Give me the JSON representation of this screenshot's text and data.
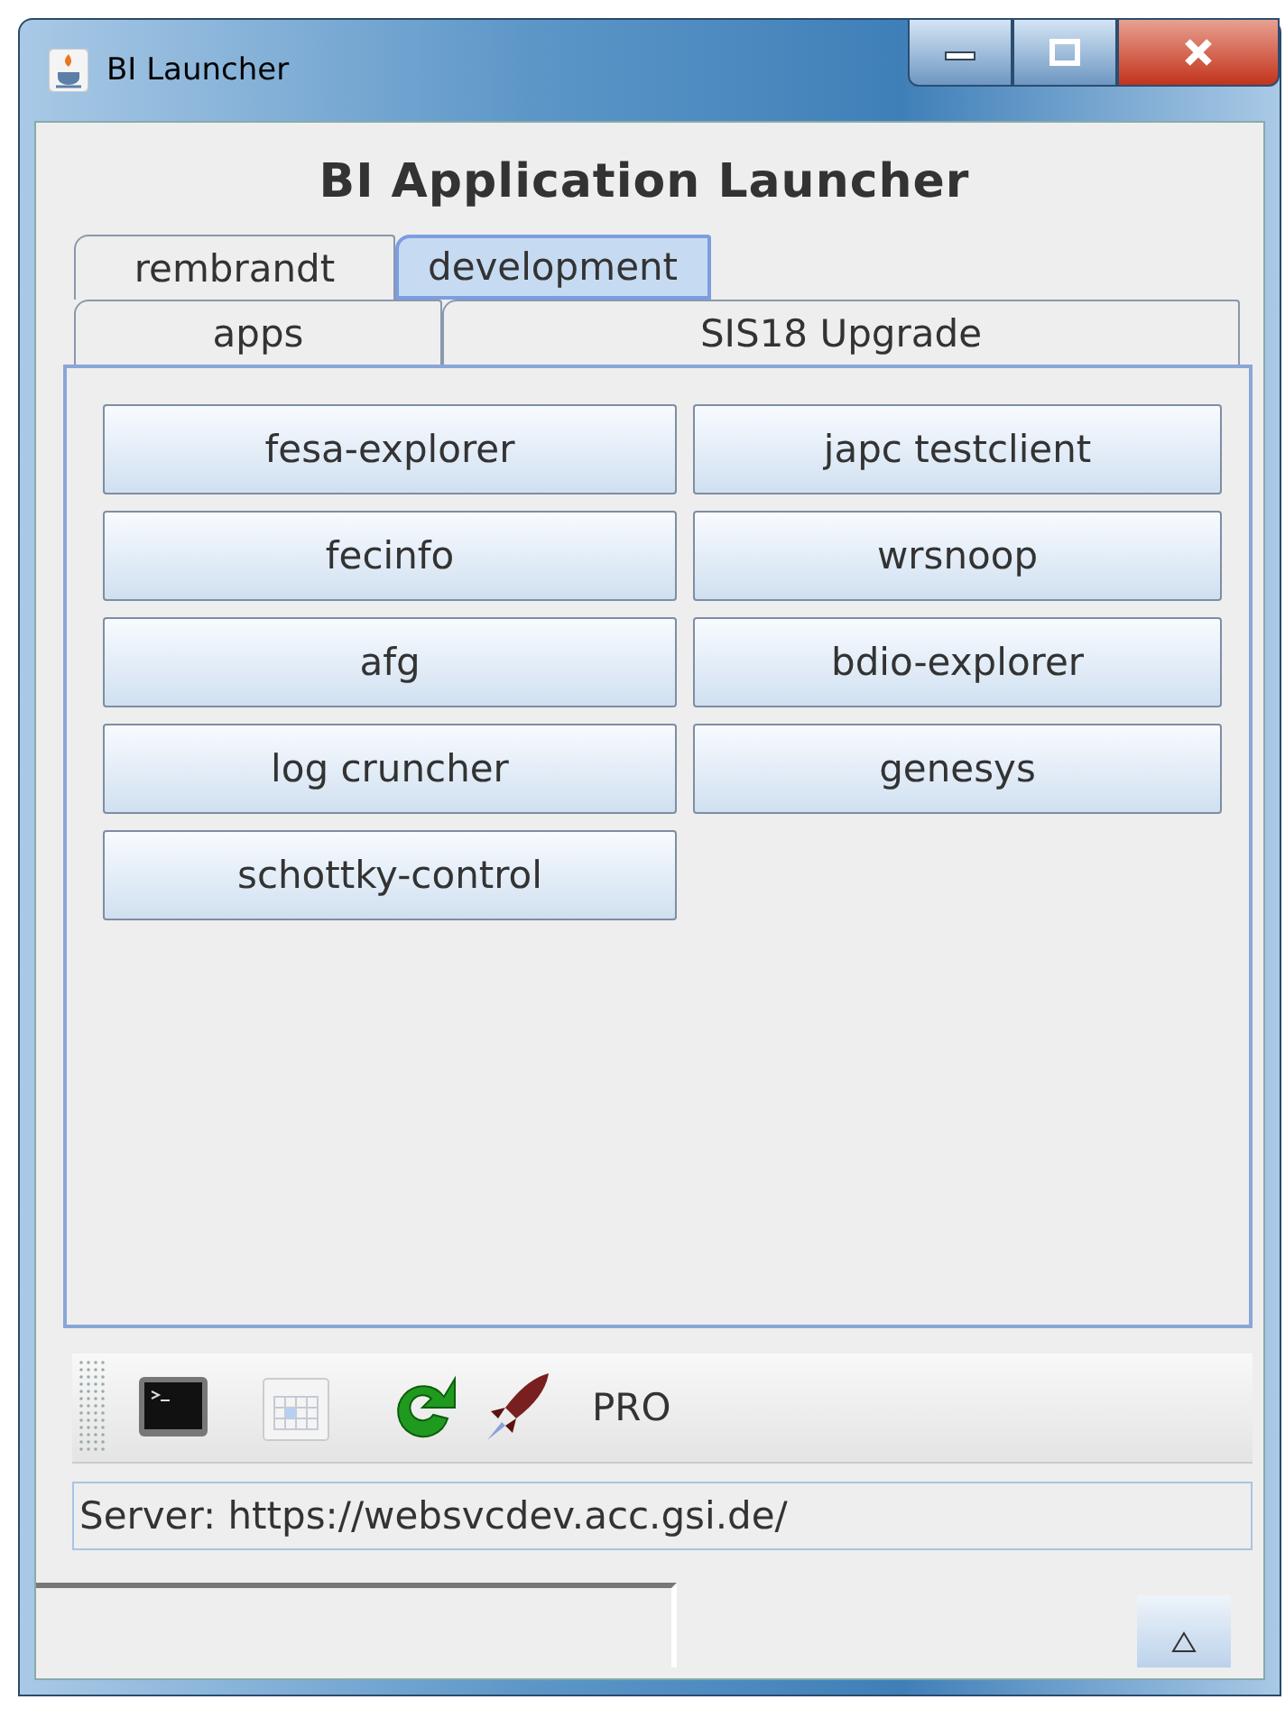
{
  "window": {
    "title": "BI Launcher"
  },
  "heading": "BI Application Launcher",
  "tab_rows": [
    [
      {
        "label": "rembrandt",
        "selected": false
      },
      {
        "label": "development",
        "selected": true
      }
    ],
    [
      {
        "label": "apps",
        "selected": false
      },
      {
        "label": "SIS18 Upgrade",
        "selected": false
      }
    ]
  ],
  "apps": [
    "fesa-explorer",
    "japc testclient",
    "fecinfo",
    "wrsnoop",
    "afg",
    "bdio-explorer",
    "log cruncher",
    "genesys",
    "schottky-control"
  ],
  "toolbar": {
    "label": "PRO"
  },
  "status": "Server: https://websvcdev.acc.gsi.de/"
}
